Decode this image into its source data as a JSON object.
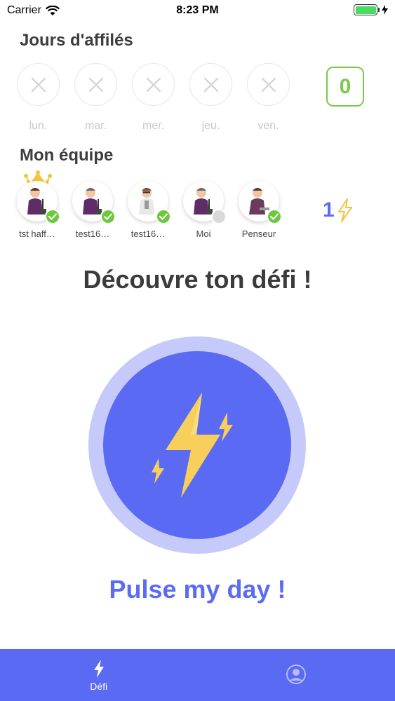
{
  "status_bar": {
    "carrier": "Carrier",
    "time": "8:23 PM"
  },
  "streak": {
    "title": "Jours d'affilés",
    "days": [
      {
        "label": "lun.",
        "done": false
      },
      {
        "label": "mar.",
        "done": false
      },
      {
        "label": "mer.",
        "done": false
      },
      {
        "label": "jeu.",
        "done": false
      },
      {
        "label": "ven.",
        "done": false
      }
    ],
    "count": "0"
  },
  "team": {
    "title": "Mon équipe",
    "members": [
      {
        "name": "tst haff…",
        "status": "done",
        "leader": true
      },
      {
        "name": "test16…",
        "status": "done",
        "leader": false
      },
      {
        "name": "test16…",
        "status": "done",
        "leader": false
      },
      {
        "name": "Moi",
        "status": "pending",
        "leader": false
      },
      {
        "name": "Penseur",
        "status": "done",
        "leader": false
      }
    ],
    "energy": "1"
  },
  "challenge": {
    "title": "Découvre ton défi !",
    "action_label": "Pulse my day !"
  },
  "tabbar": {
    "tabs": [
      {
        "label": "Défi",
        "icon": "lightning-icon",
        "active": true
      },
      {
        "label": "",
        "icon": "profile-icon",
        "active": false
      }
    ]
  },
  "colors": {
    "accent": "#5a6af2",
    "accent_light": "#c5cafa",
    "success": "#6cc83f",
    "bolt": "#f7cf5a"
  }
}
